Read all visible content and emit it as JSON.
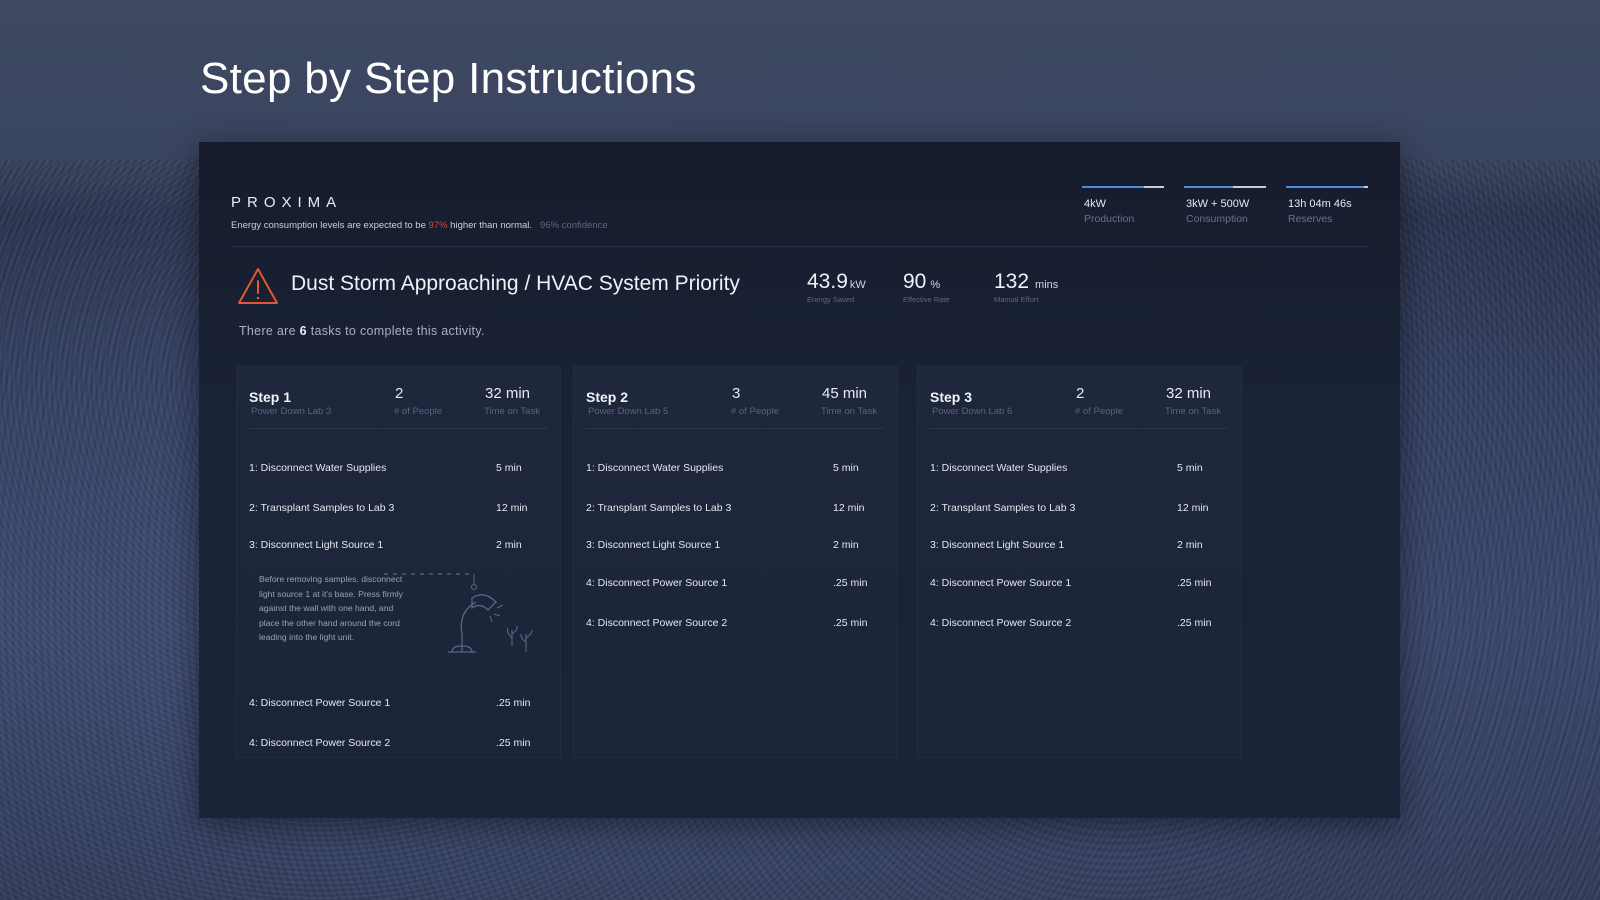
{
  "page": {
    "title": "Step by Step Instructions"
  },
  "app": {
    "brand": "PROXIMA",
    "notice": {
      "prefix": "Energy consumption levels are  expected to be ",
      "percent": "97%",
      "suffix": " higher than normal.",
      "confidence": "96% confidence"
    },
    "meters": [
      {
        "value": "4kW",
        "label": "Production",
        "level": 0.75
      },
      {
        "value": "3kW + 500W",
        "label": "Consumption",
        "level": 0.6
      },
      {
        "value": "13h 04m 46s",
        "label": "Reserves",
        "level": 0.95
      }
    ],
    "colors": {
      "accent": "#4d8fd6",
      "warning": "#e0592f",
      "alert_text": "#d9463f"
    }
  },
  "alert": {
    "icon": "warning-triangle-icon",
    "title": "Dust Storm Approaching / HVAC System Priority",
    "stats": [
      {
        "value": "43.9",
        "unit": "kW",
        "label": "Energy Saved"
      },
      {
        "value": "90",
        "unit": "%",
        "label": "Effective Rate"
      },
      {
        "value": "132",
        "unit": "mins",
        "label": "Manual Effort"
      }
    ],
    "task_count": {
      "prefix": "There are ",
      "count": "6",
      "suffix": " tasks to complete this activity."
    }
  },
  "steps": [
    {
      "title": "Step 1",
      "subtitle": "Power Down Lab 3",
      "people": "2",
      "people_label": "# of People",
      "time": "32 min",
      "time_label": "Time on Task",
      "tasks": [
        {
          "name": "1: Disconnect Water Supplies",
          "duration": "5 min"
        },
        {
          "name": "2: Transplant Samples to Lab 3",
          "duration": "12 min"
        },
        {
          "name": "3: Disconnect Light Source 1",
          "duration": "2 min"
        },
        {
          "name": "4: Disconnect Power Source 1",
          "duration": ".25 min"
        },
        {
          "name": "4: Disconnect Power Source 2",
          "duration": ".25 min"
        }
      ],
      "note": "Before removing samples, disconnect light source 1 at it's base. Press firmly against the wall with one hand, and place the other hand around the cord leading into the light unit.",
      "illustration": "desk-lamp-icon"
    },
    {
      "title": "Step 2",
      "subtitle": "Power Down Lab 5",
      "people": "3",
      "people_label": "# of People",
      "time": "45 min",
      "time_label": "Time on Task",
      "tasks": [
        {
          "name": "1: Disconnect Water Supplies",
          "duration": "5 min"
        },
        {
          "name": "2: Transplant Samples to Lab 3",
          "duration": "12 min"
        },
        {
          "name": "3: Disconnect Light Source 1",
          "duration": "2 min"
        },
        {
          "name": "4: Disconnect Power Source 1",
          "duration": ".25 min"
        },
        {
          "name": "4: Disconnect Power Source 2",
          "duration": ".25 min"
        }
      ]
    },
    {
      "title": "Step 3",
      "subtitle": "Power Down Lab 6",
      "people": "2",
      "people_label": "# of People",
      "time": "32 min",
      "time_label": "Time on Task",
      "tasks": [
        {
          "name": "1: Disconnect Water Supplies",
          "duration": "5 min"
        },
        {
          "name": "2: Transplant Samples to Lab 3",
          "duration": "12 min"
        },
        {
          "name": "3: Disconnect Light Source 1",
          "duration": "2 min"
        },
        {
          "name": "4: Disconnect Power Source 1",
          "duration": ".25 min"
        },
        {
          "name": "4: Disconnect Power Source 2",
          "duration": ".25 min"
        }
      ]
    }
  ]
}
